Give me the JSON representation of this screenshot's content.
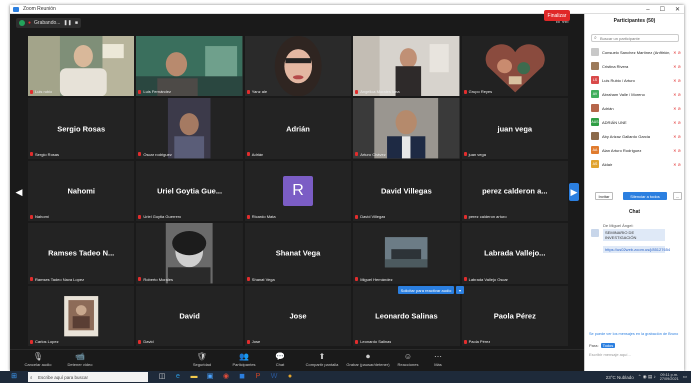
{
  "window": {
    "title": "Zoom Reunión",
    "min": "–",
    "max": "☐",
    "close": "✕"
  },
  "topbar": {
    "recording_label": "Grabando...",
    "view_label": "☷ Ver"
  },
  "tiles": [
    {
      "name": "",
      "label": "Luis rubio",
      "video": true,
      "active": true,
      "scene": "man1"
    },
    {
      "name": "",
      "label": "Luis Fernández",
      "video": true,
      "scene": "man2"
    },
    {
      "name": "",
      "label": "Yanz ale",
      "video": true,
      "scene": "woman1"
    },
    {
      "name": "",
      "label": "Angelica Morales luna",
      "video": true,
      "scene": "woman2"
    },
    {
      "name": "",
      "label": "Grupo Reyes",
      "video": true,
      "scene": "heart"
    },
    {
      "name": "Sergio Rosas",
      "label": "Sergio Rosas"
    },
    {
      "name": "",
      "label": "Oscar rodriguez",
      "video": true,
      "scene": "man3"
    },
    {
      "name": "Adrián",
      "label": "Adrián"
    },
    {
      "name": "",
      "label": "Arturo Chávez",
      "video": true,
      "scene": "man4"
    },
    {
      "name": "juan vega",
      "label": "juan vega"
    },
    {
      "name": "Nahomi",
      "label": "Nahomi"
    },
    {
      "name": "Uriel Goytia Gue...",
      "label": "Uriel Goytia Guerrero"
    },
    {
      "name": "",
      "label": "Ricardo Mata",
      "avatar": "R"
    },
    {
      "name": "David Villegas",
      "label": "David Villegas"
    },
    {
      "name": "perez calderon a...",
      "label": "perez calderon arturo"
    },
    {
      "name": "Ramses Tadeo N...",
      "label": "Ramses Tadeo Nava Lopez"
    },
    {
      "name": "",
      "label": "Roberto Morales",
      "video": true,
      "scene": "bw"
    },
    {
      "name": "Shanat Vega",
      "label": "Shanat Vega"
    },
    {
      "name": "",
      "label": "Miguel Hernández",
      "video": true,
      "scene": "car"
    },
    {
      "name": "Labrada Vallejo...",
      "label": "Labrada Vallejo Oscar"
    },
    {
      "name": "",
      "label": "Carlos Lopez",
      "video": true,
      "scene": "photo"
    },
    {
      "name": "David",
      "label": "David"
    },
    {
      "name": "Jose",
      "label": "Jose"
    },
    {
      "name": "Leonardo Salinas",
      "label": "Leonardo Salinas"
    },
    {
      "name": "Paola Pérez",
      "label": "Paola Pérez"
    }
  ],
  "ask_button": "Solicitar para reactivar audio",
  "toolbar": {
    "items": [
      {
        "icon": "🎙",
        "label": "Cancelar audio"
      },
      {
        "icon": "📹",
        "label": "Detener video"
      },
      {
        "icon": "🛡",
        "label": "Seguridad"
      },
      {
        "icon": "👥",
        "label": "Participantes"
      },
      {
        "icon": "💬",
        "label": "Chat"
      },
      {
        "icon": "⬆",
        "label": "Compartir pantalla"
      },
      {
        "icon": "⏺",
        "label": "Grabar (pausar/detener)"
      },
      {
        "icon": "☺",
        "label": "Reacciones"
      },
      {
        "icon": "⋯",
        "label": "Más"
      }
    ],
    "end_label": "Finalizar"
  },
  "participants": {
    "title": "Participantes (50)",
    "search_placeholder": "Buscar un participante",
    "list": [
      {
        "initials": "",
        "name": "Consuelo Sanchez Martínez (Anfitrión, yo)",
        "color": "#c8c8c8"
      },
      {
        "initials": "",
        "name": "Cristina Rivera",
        "color": "#9c7a5a"
      },
      {
        "initials": "LS",
        "name": "Luis Rubio / Arturo",
        "color": "#d94a4a"
      },
      {
        "initials": "AV",
        "name": "Abraham Valle / Moreno",
        "color": "#3fae5c"
      },
      {
        "initials": "",
        "name": "Adrián",
        "color": "#b5654a"
      },
      {
        "initials": "AUS",
        "name": "ADRIÁN UNE",
        "color": "#2f9e44"
      },
      {
        "initials": "",
        "name": "Aby Arizaz Gallardo Garcia",
        "color": "#8c6a4a"
      },
      {
        "initials": "AA",
        "name": "Alan Arturo Rodríguez",
        "color": "#e07b2e"
      },
      {
        "initials": "AS",
        "name": "Aldair",
        "color": "#e0a32e"
      }
    ],
    "invite_label": "Invitar",
    "unmute_all_label": "Silenciar a todos",
    "more_label": "..."
  },
  "chat": {
    "title": "Chat",
    "from_label": "De Miguel Ángel:",
    "message1": "SEMINARIO DE INVESTIGACIÓN",
    "message2": "https://us02web.zoom.us/j/85127654",
    "status": "Se puede ver los mensajes en la grabación de Bruno",
    "to_label": "Para:",
    "to_value": "Todos",
    "input_placeholder": "Escribir mensaje aquí..."
  },
  "taskbar": {
    "search_placeholder": "Escribe aquí para buscar",
    "weather": "23°C Nublado",
    "time": "09:11 p.m.",
    "date": "27/09/2021"
  }
}
